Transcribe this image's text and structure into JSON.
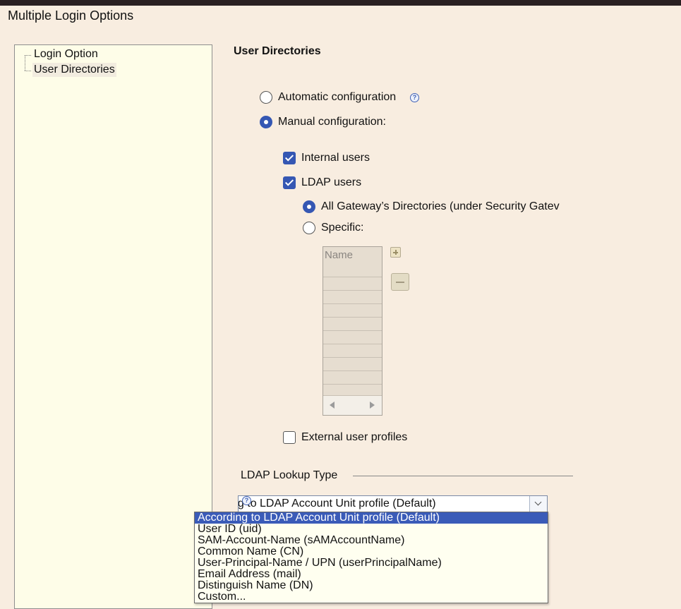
{
  "window": {
    "title": "Multiple Login Options"
  },
  "tree": {
    "items": [
      {
        "label": "Login Option",
        "selected": false
      },
      {
        "label": "User Directories",
        "selected": true
      }
    ]
  },
  "section": {
    "title": "User Directories"
  },
  "config": {
    "automatic_label": "Automatic configuration",
    "automatic_selected": false,
    "manual_label": "Manual configuration:",
    "manual_selected": true,
    "internal_users_label": "Internal users",
    "internal_users_checked": true,
    "ldap_users_label": "LDAP users",
    "ldap_users_checked": true,
    "all_gateways_label": "All Gateway’s Directories (under Security Gatev",
    "all_gateways_selected": true,
    "specific_label": "Specific:",
    "specific_selected": false,
    "external_profiles_label": "External user profiles",
    "external_profiles_checked": false
  },
  "name_table": {
    "header": "Name",
    "rows": [
      "",
      "",
      "",
      "",
      "",
      "",
      "",
      "",
      ""
    ]
  },
  "help_icon": "?",
  "ldap_lookup": {
    "group_title": "LDAP Lookup Type",
    "selected_text": "ng to LDAP Account Unit profile (Default)",
    "options": [
      "According to LDAP Account Unit profile (Default)",
      "User ID (uid)",
      "SAM-Account-Name (sAMAccountName)",
      "Common Name (CN)",
      "User-Principal-Name / UPN (userPrincipalName)",
      "Email Address (mail)",
      "Distinguish Name (DN)",
      "Custom..."
    ],
    "highlighted_index": 0
  },
  "colors": {
    "accent": "#3557b3",
    "selection": "#3a5bb8",
    "background": "#f8ede0",
    "panel": "#fefde8"
  }
}
